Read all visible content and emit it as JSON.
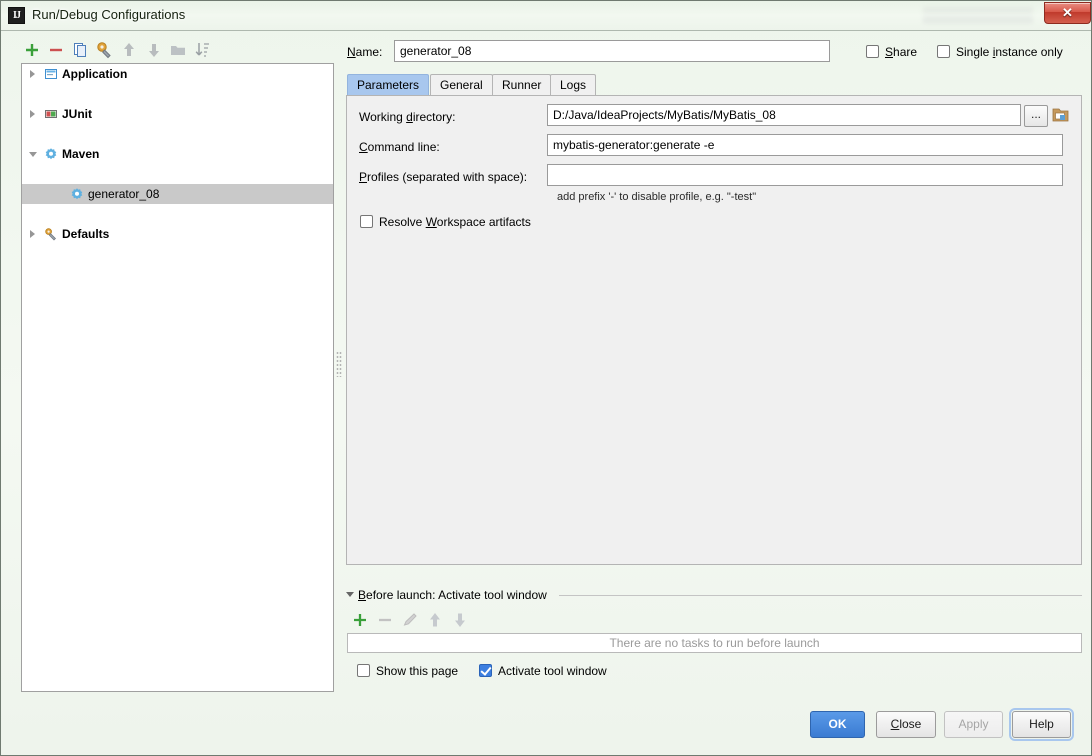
{
  "window": {
    "title": "Run/Debug Configurations",
    "app_icon": "intellij-idea-icon",
    "close_label": "✕"
  },
  "toolbar": {
    "buttons": [
      {
        "name": "add-configuration-button",
        "icon": "plus-icon",
        "label": "+"
      },
      {
        "name": "remove-configuration-button",
        "icon": "minus-icon",
        "label": "−"
      },
      {
        "name": "copy-configuration-button",
        "icon": "copy-icon",
        "label": "Copy"
      },
      {
        "name": "edit-templates-button",
        "icon": "wrench-gear-icon",
        "label": "Edit defaults"
      },
      {
        "name": "move-up-button",
        "icon": "arrow-up-icon",
        "label": "Move Up"
      },
      {
        "name": "move-down-button",
        "icon": "arrow-down-icon",
        "label": "Move Down"
      },
      {
        "name": "create-folder-button",
        "icon": "folder-icon",
        "label": "Create Folder"
      },
      {
        "name": "sort-button",
        "icon": "sort-alphabetically-icon",
        "label": "Sort Configurations"
      }
    ]
  },
  "tree": {
    "items": [
      {
        "label": "Application",
        "icon": "application-icon",
        "expanded": false,
        "has_arrow": true,
        "child": false,
        "selected": false
      },
      {
        "label": "JUnit",
        "icon": "junit-icon",
        "expanded": false,
        "has_arrow": true,
        "child": false,
        "selected": false
      },
      {
        "label": "Maven",
        "icon": "maven-gear-icon",
        "expanded": true,
        "has_arrow": true,
        "child": false,
        "selected": false
      },
      {
        "label": "generator_08",
        "icon": "maven-gear-icon",
        "expanded": false,
        "has_arrow": false,
        "child": true,
        "selected": true
      },
      {
        "label": "Defaults",
        "icon": "defaults-wrench-icon",
        "expanded": false,
        "has_arrow": true,
        "child": false,
        "selected": false
      }
    ]
  },
  "header": {
    "name_label": "Name:",
    "name_value": "generator_08",
    "share_label": "Share",
    "share_checked": false,
    "single_instance_label": "Single instance only",
    "single_instance_checked": false
  },
  "tabs": [
    {
      "label": "Parameters",
      "active": true
    },
    {
      "label": "General",
      "active": false
    },
    {
      "label": "Runner",
      "active": false
    },
    {
      "label": "Logs",
      "active": false
    }
  ],
  "parameters": {
    "working_directory_label": "Working directory:",
    "working_directory_value": "D:/Java/IdeaProjects/MyBatis/MyBatis_08",
    "browse_button_label": "...",
    "folder_icon": "folder-open-icon",
    "command_line_label": "Command line:",
    "command_line_value": "mybatis-generator:generate -e",
    "profiles_label": "Profiles (separated with space):",
    "profiles_value": "",
    "profiles_hint": "add prefix '-' to disable profile, e.g. \"-test\"",
    "resolve_workspace_label": "Resolve Workspace artifacts",
    "resolve_workspace_checked": false
  },
  "before_launch": {
    "title": "Before launch: Activate tool window",
    "collapsed": false,
    "buttons": [
      {
        "name": "add-task-button",
        "icon": "plus-icon",
        "enabled": true
      },
      {
        "name": "remove-task-button",
        "icon": "minus-icon",
        "enabled": false
      },
      {
        "name": "edit-task-button",
        "icon": "pencil-icon",
        "enabled": false
      },
      {
        "name": "move-task-up-button",
        "icon": "arrow-up-icon",
        "enabled": false
      },
      {
        "name": "move-task-down-button",
        "icon": "arrow-down-icon",
        "enabled": false
      }
    ],
    "empty_text": "There are no tasks to run before launch",
    "show_page_label": "Show this page",
    "show_page_checked": false,
    "activate_tool_window_label": "Activate tool window",
    "activate_tool_window_checked": true
  },
  "footer": {
    "ok_label": "OK",
    "close_label": "Close",
    "apply_label": "Apply",
    "apply_enabled": false,
    "help_label": "Help"
  },
  "colors": {
    "accent": "#3a7bd2",
    "tab_active": "#a8c7ee",
    "selection": "#c9c9c9",
    "titlebar": "#eef5ec",
    "close_button": "#c03a2c"
  }
}
